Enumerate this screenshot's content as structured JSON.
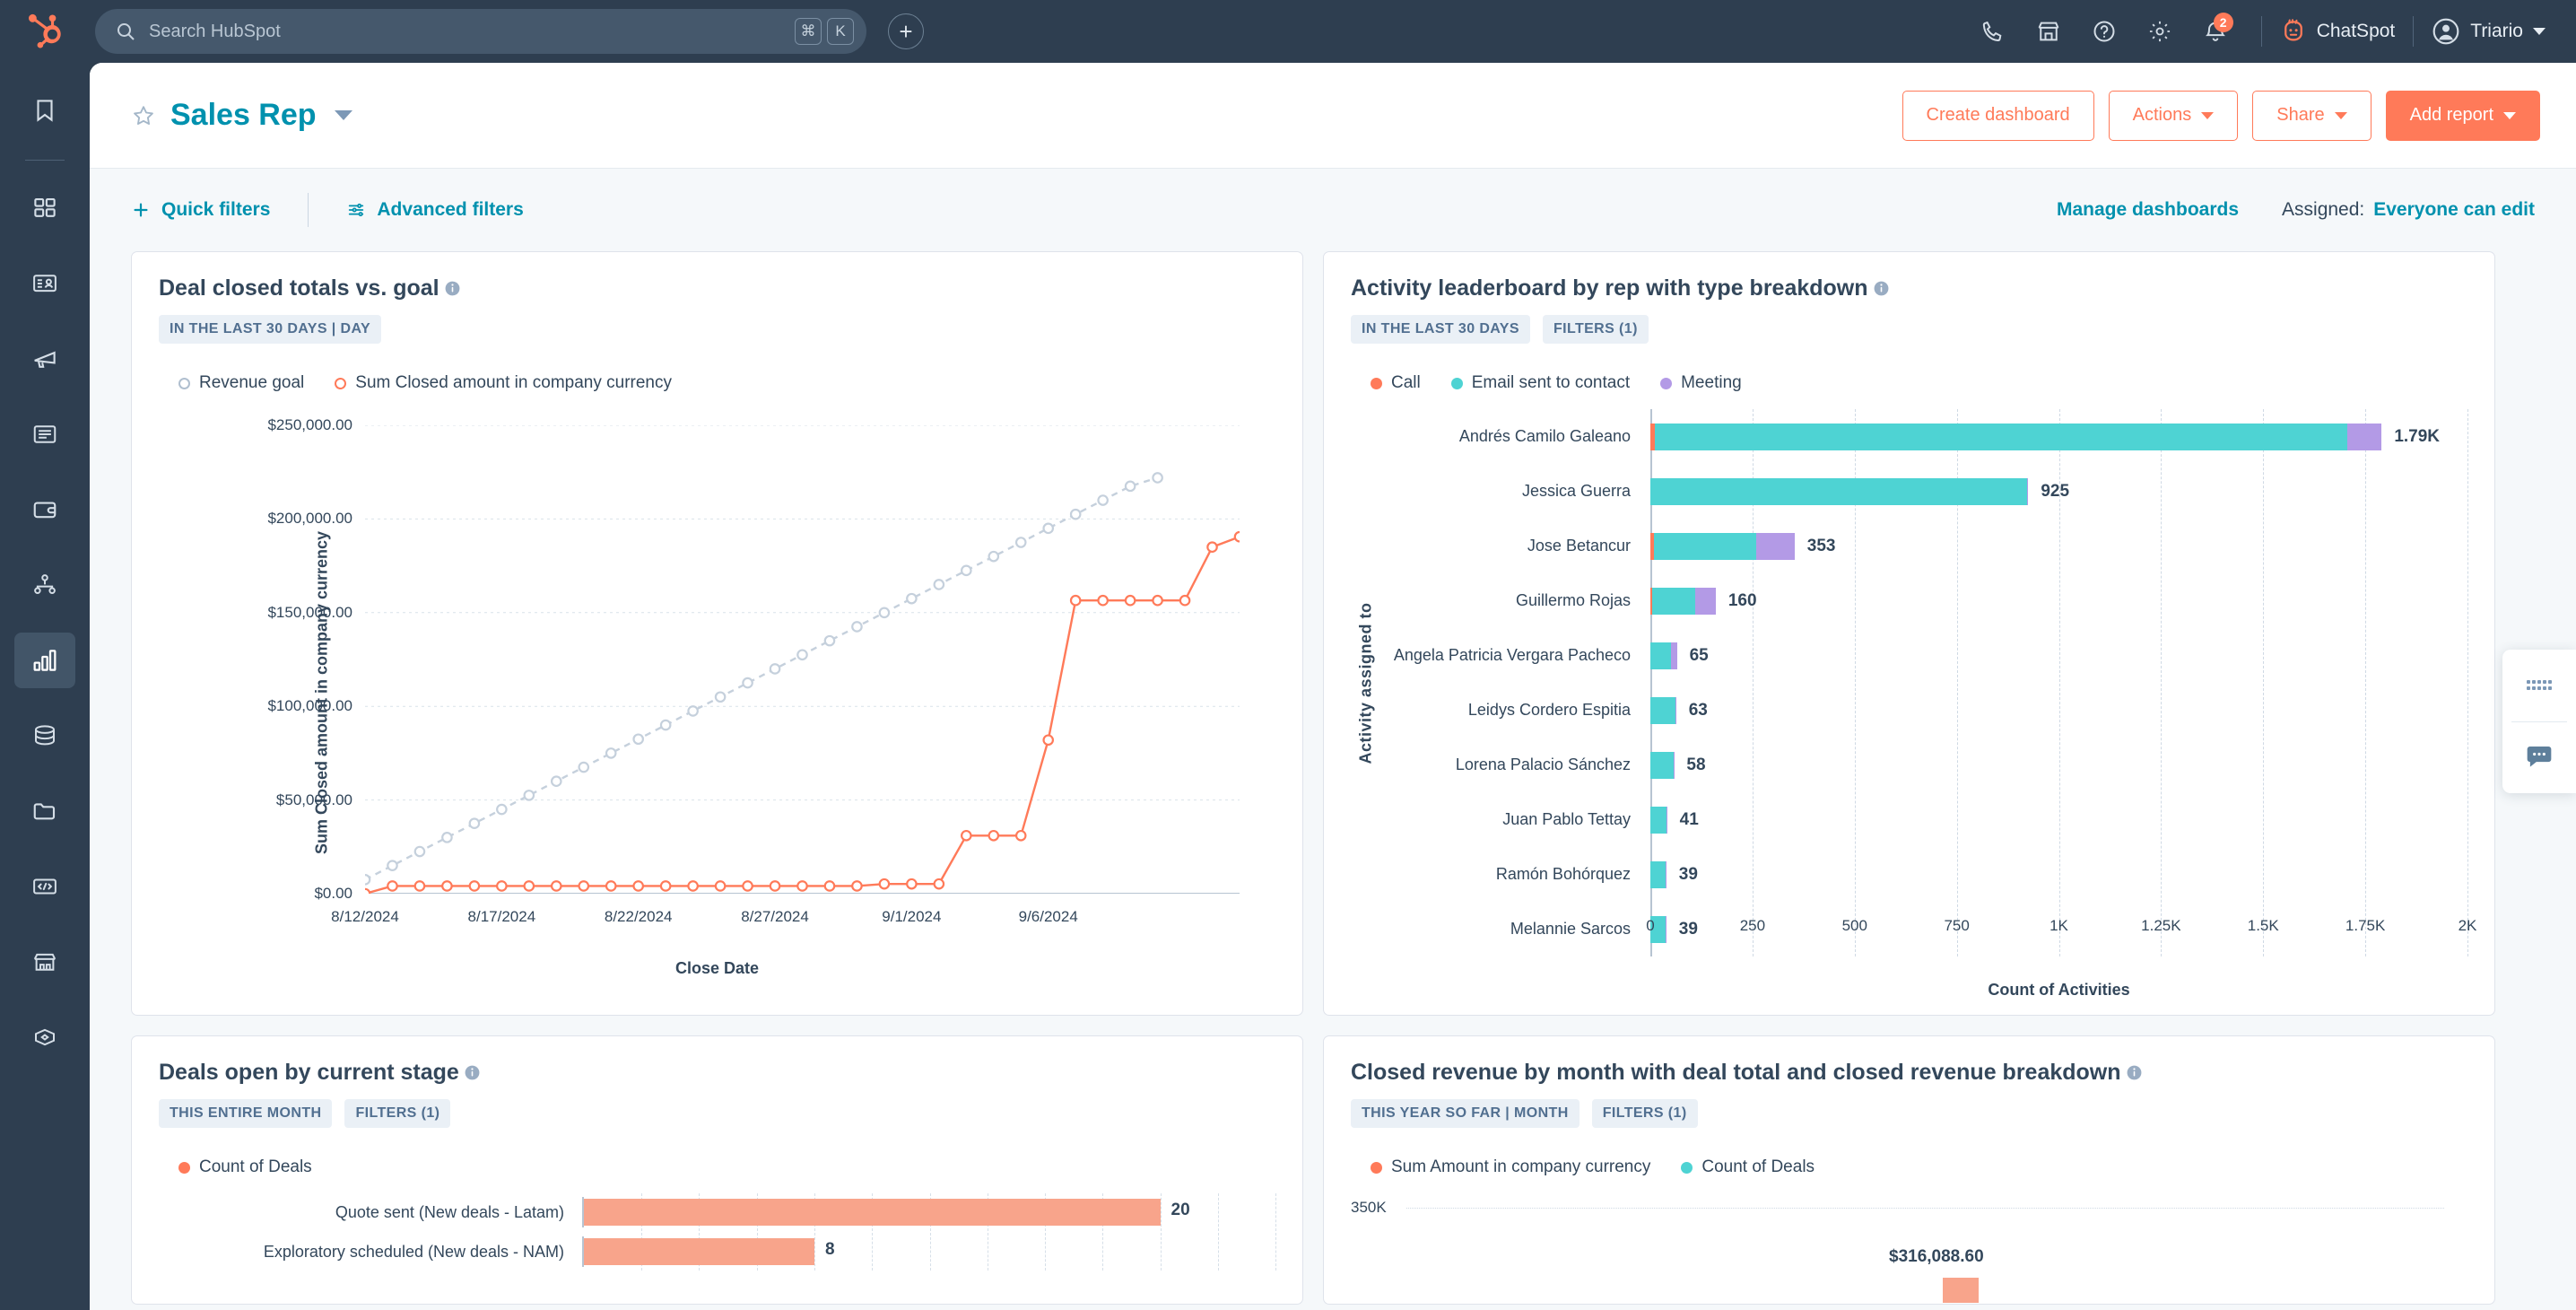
{
  "topnav": {
    "logo_icon": "hubspot-sprocket-logo",
    "search": {
      "placeholder": "Search HubSpot",
      "value": "",
      "icon": "search-icon",
      "kbd": [
        "⌘",
        "K"
      ]
    },
    "create_label": "+",
    "icons": [
      {
        "name": "calling-icon",
        "glyph": "phone"
      },
      {
        "name": "marketplace-icon",
        "glyph": "storefront"
      },
      {
        "name": "help-icon",
        "glyph": "question-circle"
      },
      {
        "name": "settings-icon",
        "glyph": "gear"
      },
      {
        "name": "notifications-icon",
        "glyph": "bell",
        "badge": "2"
      }
    ],
    "chatspot": {
      "label": "ChatSpot",
      "icon": "chatspot-icon"
    },
    "account": {
      "name": "Triario",
      "icon": "avatar"
    }
  },
  "sidebar": {
    "items": [
      {
        "name": "bookmarks",
        "icon": "bookmark-icon",
        "active": false
      },
      {
        "name": "workspaces",
        "icon": "grid-icon",
        "active": false
      },
      {
        "name": "crm-contacts",
        "icon": "contact-card-icon",
        "active": false
      },
      {
        "name": "marketing",
        "icon": "megaphone-icon",
        "active": false
      },
      {
        "name": "content",
        "icon": "article-icon",
        "active": false
      },
      {
        "name": "commerce",
        "icon": "wallet-icon",
        "active": false
      },
      {
        "name": "automation",
        "icon": "workflow-nodes-icon",
        "active": false
      },
      {
        "name": "reporting",
        "icon": "bar-chart-icon",
        "active": true
      },
      {
        "name": "data-management",
        "icon": "database-icon",
        "active": false
      },
      {
        "name": "library",
        "icon": "folder-icon",
        "active": false
      },
      {
        "name": "developer",
        "icon": "code-brackets-icon",
        "active": false
      },
      {
        "name": "app-marketplace",
        "icon": "storefront-icon",
        "active": false
      },
      {
        "name": "integrations",
        "icon": "diamond-hex-icon",
        "active": false
      }
    ]
  },
  "page": {
    "title": "Sales Rep",
    "star_icon": "star-outline-icon",
    "title_caret": "chevron-down-icon",
    "buttons": [
      {
        "label": "Create dashboard",
        "style": "outline",
        "caret": false
      },
      {
        "label": "Actions",
        "style": "outline",
        "caret": true
      },
      {
        "label": "Share",
        "style": "outline",
        "caret": true
      },
      {
        "label": "Add report",
        "style": "filled",
        "caret": true
      }
    ]
  },
  "filterbar": {
    "quick_filters": "Quick filters",
    "advanced_filters": "Advanced filters",
    "manage_dashboards": "Manage dashboards",
    "assigned_label": "Assigned:",
    "assigned_value": "Everyone can edit"
  },
  "colors": {
    "orange": "#ff7a59",
    "orange_light": "#f8a48b",
    "teal": "#4ed3d3",
    "purple": "#b39ae6",
    "gray_line": "#c5d0dc",
    "link": "#0091ae",
    "text": "#33475b"
  },
  "chart_data": [
    {
      "id": "deal-closed-totals-vs-goal",
      "type": "line",
      "title": "Deal closed totals vs. goal",
      "tags": [
        "IN THE LAST 30 DAYS | DAY"
      ],
      "xlabel": "Close Date",
      "ylabel": "Sum Closed amount in company currency",
      "ylim": [
        0,
        250000
      ],
      "yticks": [
        "$0.00",
        "$50,000.00",
        "$100,000.00",
        "$150,000.00",
        "$200,000.00",
        "$250,000.00"
      ],
      "ytick_values": [
        0,
        50000,
        100000,
        150000,
        200000,
        250000
      ],
      "xticks": [
        "8/12/2024",
        "8/17/2024",
        "8/22/2024",
        "8/27/2024",
        "9/1/2024",
        "9/6/2024"
      ],
      "xtick_index": [
        0,
        5,
        10,
        15,
        20,
        25
      ],
      "grid": true,
      "legend_position": "top-left",
      "series": [
        {
          "name": "Revenue goal",
          "color": "#c5d0dc",
          "style": "dashed",
          "values": [
            7500,
            15000,
            22500,
            30000,
            37500,
            45000,
            52500,
            60000,
            67500,
            75000,
            82500,
            90000,
            97500,
            105000,
            112500,
            120000,
            127500,
            135000,
            142500,
            150000,
            157500,
            165000,
            172500,
            180000,
            187500,
            195000,
            202500,
            210000,
            217500,
            222000
          ]
        },
        {
          "name": "Sum Closed amount in company currency",
          "color": "#ff7a59",
          "style": "solid",
          "values": [
            0,
            4100,
            4100,
            4100,
            4100,
            4100,
            4100,
            4100,
            4100,
            4100,
            4100,
            4100,
            4100,
            4100,
            4100,
            4100,
            4100,
            4100,
            4100,
            5200,
            5200,
            5200,
            31000,
            31000,
            31000,
            82000,
            156500,
            156500,
            156500,
            156500,
            156500,
            185000,
            190500
          ]
        }
      ]
    },
    {
      "id": "activity-leaderboard-by-rep",
      "type": "bar",
      "orientation": "horizontal",
      "stacked": true,
      "title": "Activity leaderboard by rep with type breakdown",
      "tags": [
        "IN THE LAST 30 DAYS",
        "FILTERS (1)"
      ],
      "xlabel": "Count of Activities",
      "ylabel": "Activity assigned to",
      "xlim": [
        0,
        2000
      ],
      "xticks": [
        "0",
        "250",
        "500",
        "750",
        "1K",
        "1.25K",
        "1.5K",
        "1.75K",
        "2K"
      ],
      "xtick_values": [
        0,
        250,
        500,
        750,
        1000,
        1250,
        1500,
        1750,
        2000
      ],
      "legend_position": "top-left",
      "legend": [
        {
          "name": "Call",
          "color": "#ff7a59"
        },
        {
          "name": "Email sent to contact",
          "color": "#4ed3d3"
        },
        {
          "name": "Meeting",
          "color": "#b39ae6"
        }
      ],
      "categories": [
        "Andrés Camilo Galeano",
        "Jessica Guerra",
        "Jose Betancur",
        "Guillermo Rojas",
        "Angela Patricia Vergara Pacheco",
        "Leidys Cordero Espitia",
        "Lorena Palacio Sánchez",
        "Juan Pablo Tettay",
        "Ramón Bohórquez",
        "Melannie Sarcos"
      ],
      "total_labels": [
        "1.79K",
        "925",
        "353",
        "160",
        "65",
        "63",
        "58",
        "41",
        "39",
        "39"
      ],
      "totals": [
        1790,
        925,
        353,
        160,
        65,
        63,
        58,
        41,
        39,
        39
      ],
      "segments": [
        {
          "call": 11,
          "email": 1694,
          "meeting": 85
        },
        {
          "call": 0,
          "email": 921,
          "meeting": 4
        },
        {
          "call": 9,
          "email": 249,
          "meeting": 95
        },
        {
          "call": 5,
          "email": 105,
          "meeting": 50
        },
        {
          "call": 1,
          "email": 50,
          "meeting": 14
        },
        {
          "call": 0,
          "email": 62,
          "meeting": 1
        },
        {
          "call": 0,
          "email": 57,
          "meeting": 1
        },
        {
          "call": 0,
          "email": 40,
          "meeting": 1
        },
        {
          "call": 0,
          "email": 38,
          "meeting": 1
        },
        {
          "call": 0,
          "email": 38,
          "meeting": 1
        }
      ]
    },
    {
      "id": "deals-open-by-current-stage",
      "type": "bar",
      "orientation": "horizontal",
      "title": "Deals open by current stage",
      "tags": [
        "THIS ENTIRE MONTH",
        "FILTERS (1)"
      ],
      "legend": [
        {
          "name": "Count of Deals",
          "color": "#ff7a59"
        }
      ],
      "categories": [
        "Quote sent (New deals - Latam)",
        "Exploratory scheduled (New deals - NAM)"
      ],
      "values": [
        20,
        8
      ],
      "value_labels": [
        "20",
        "8"
      ],
      "xlim": [
        0,
        24
      ]
    },
    {
      "id": "closed-revenue-by-month",
      "type": "bar",
      "orientation": "vertical",
      "title": "Closed revenue by month with deal total and closed revenue breakdown",
      "tags": [
        "THIS YEAR SO FAR | MONTH",
        "FILTERS (1)"
      ],
      "legend": [
        {
          "name": "Sum Amount in company currency",
          "color": "#ff7a59"
        },
        {
          "name": "Count of Deals",
          "color": "#4ed3d3"
        }
      ],
      "yticks": [
        "350K"
      ],
      "ytick_values": [
        350000
      ],
      "data_labels": [
        "$316,088.60"
      ],
      "values": [
        316088.6
      ]
    }
  ],
  "floatwidget": {
    "items": [
      {
        "name": "apps-grid",
        "icon": "dots-grid-icon"
      },
      {
        "name": "chat",
        "icon": "chat-bubble-icon"
      }
    ]
  }
}
